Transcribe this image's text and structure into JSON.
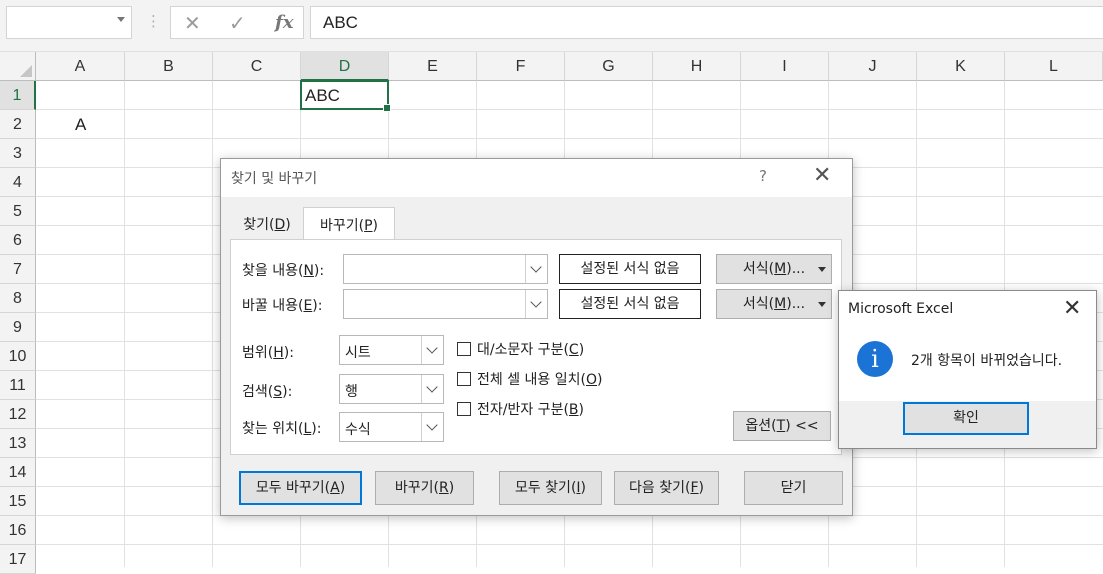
{
  "formula_bar": {
    "name_box": "",
    "cancel_icon": "✕",
    "enter_icon": "✓",
    "fx_label": "fx",
    "formula_value": "ABC"
  },
  "grid": {
    "columns": [
      "A",
      "B",
      "C",
      "D",
      "E",
      "F",
      "G",
      "H",
      "I",
      "J",
      "K",
      "L"
    ],
    "rows": [
      "1",
      "2",
      "3",
      "4",
      "5",
      "6",
      "7",
      "8",
      "9",
      "10",
      "11",
      "12",
      "13",
      "14",
      "15",
      "16",
      "17"
    ],
    "selected_column": "D",
    "selected_row": "1",
    "cells": {
      "D1": "ABC",
      "A2": "A"
    }
  },
  "find_replace": {
    "title": "찾기 및 바꾸기",
    "help": "?",
    "close": "✕",
    "tabs": [
      {
        "label": "찾기(",
        "key": "D",
        "tail": ")"
      },
      {
        "label": "바꾸기(",
        "key": "P",
        "tail": ")"
      }
    ],
    "find_label": {
      "pre": "찾을 내용(",
      "key": "N",
      "post": "):"
    },
    "replace_label": {
      "pre": "바꿀 내용(",
      "key": "E",
      "post": "):"
    },
    "no_format": "설정된 서식 없음",
    "format_button": {
      "pre": "서식(",
      "key": "M",
      "post": ")..."
    },
    "scope_label": {
      "pre": "범위(",
      "key": "H",
      "post": "):"
    },
    "scope_value": "시트",
    "search_label": {
      "pre": "검색(",
      "key": "S",
      "post": "):"
    },
    "search_value": "행",
    "lookin_label": {
      "pre": "찾는 위치(",
      "key": "L",
      "post": "):"
    },
    "lookin_value": "수식",
    "match_case": {
      "pre": "대/소문자 구분(",
      "key": "C",
      "post": ")"
    },
    "match_entire": {
      "pre": "전체 셀 내용 일치(",
      "key": "O",
      "post": ")"
    },
    "match_byte": {
      "pre": "전자/반자 구분(",
      "key": "B",
      "post": ")"
    },
    "options_button": {
      "pre": "옵션(",
      "key": "T",
      "post": ") <<"
    },
    "replace_all": {
      "pre": "모두 바꾸기(",
      "key": "A",
      "post": ")"
    },
    "replace": {
      "pre": "바꾸기(",
      "key": "R",
      "post": ")"
    },
    "find_all": {
      "pre": "모두 찾기(",
      "key": "I",
      "post": ")"
    },
    "find_next": {
      "pre": "다음 찾기(",
      "key": "F",
      "post": ")"
    },
    "close_button": "닫기"
  },
  "message_box": {
    "title": "Microsoft Excel",
    "close": "✕",
    "icon": "i",
    "message": "2개 항목이 바뀌었습니다.",
    "ok": "확인"
  }
}
